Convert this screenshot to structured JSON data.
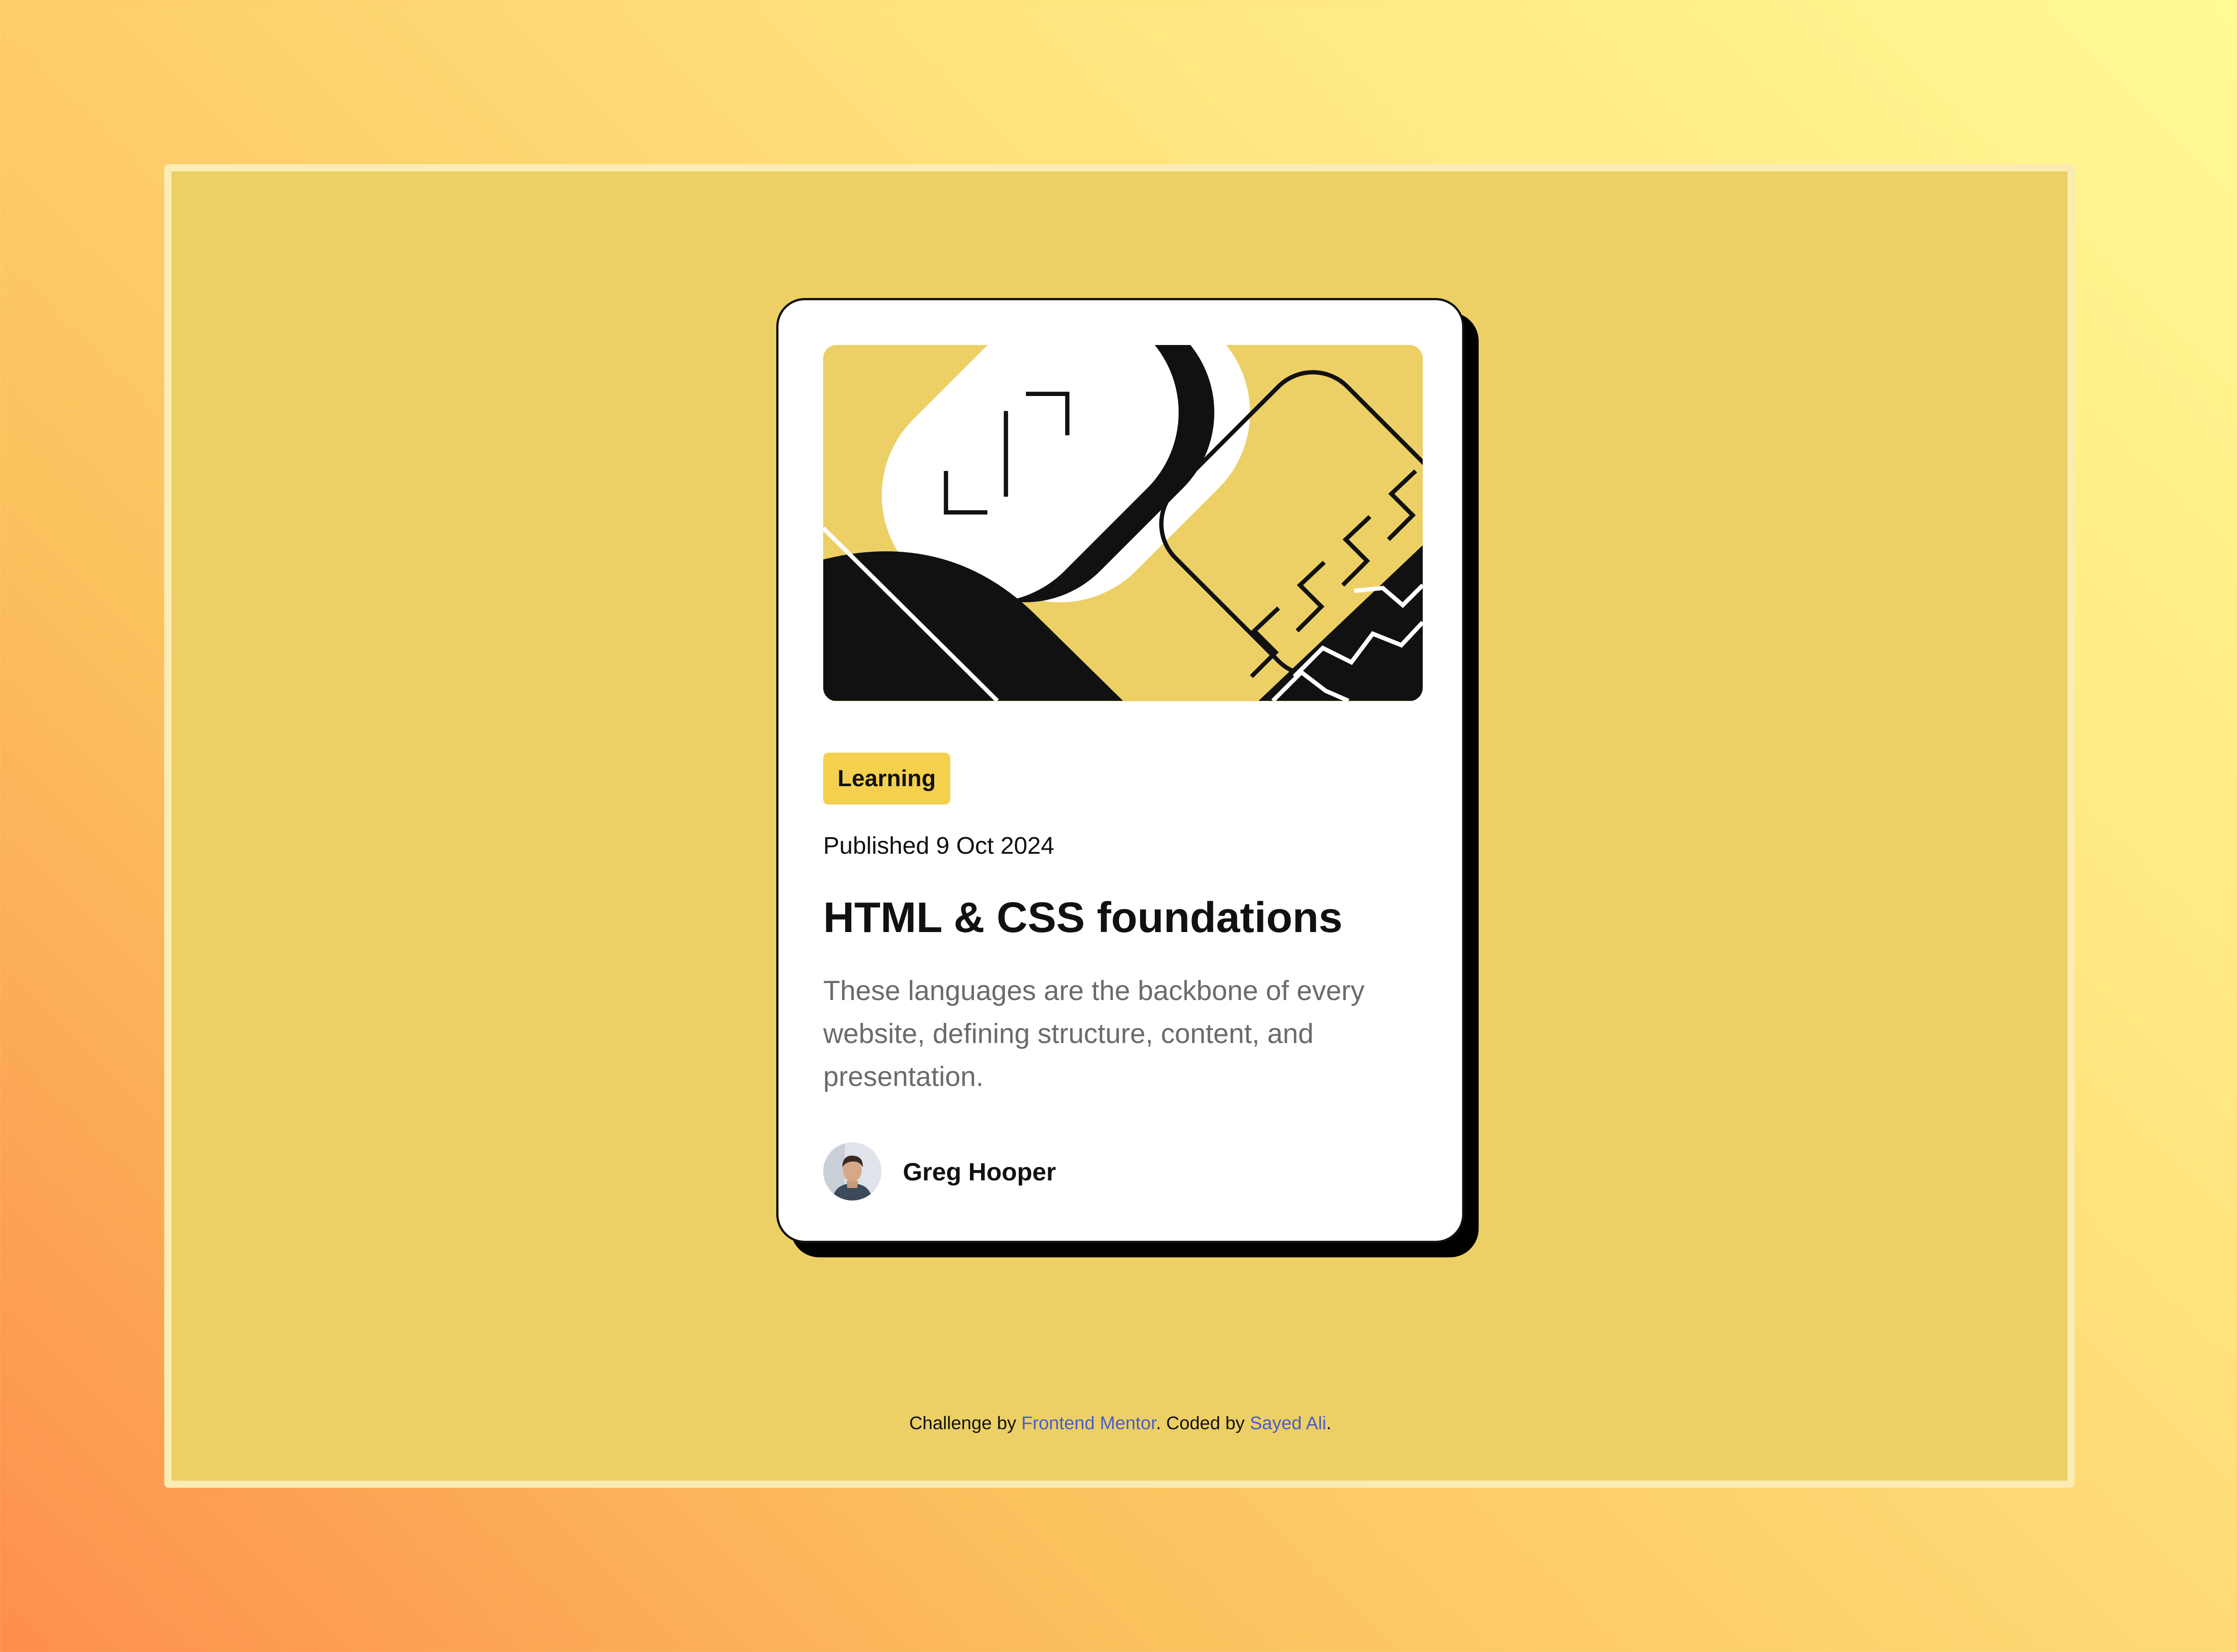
{
  "page": {
    "background_gradient": [
      "#fffa96",
      "#fd8e4e"
    ],
    "panel_color": "#ecd066"
  },
  "card": {
    "illustration_icon": "html-css-illustration",
    "tag": "Learning",
    "date": "Published 9 Oct 2024",
    "title": "HTML & CSS foundations",
    "description": "These languages are the backbone of every website, defining structure, content, and presentation.",
    "author": {
      "name": "Greg Hooper",
      "avatar_icon": "avatar-photo"
    },
    "colors": {
      "tag_bg": "#f4d04e",
      "text": "#111111",
      "description": "#6b6b6b",
      "shadow": "#000000"
    }
  },
  "attribution": {
    "prefix": "Challenge by ",
    "challenge_link": "Frontend Mentor",
    "middle": ". Coded by ",
    "coder_link": "Sayed Ali",
    "suffix": ".",
    "link_color": "#4a5dc8"
  }
}
